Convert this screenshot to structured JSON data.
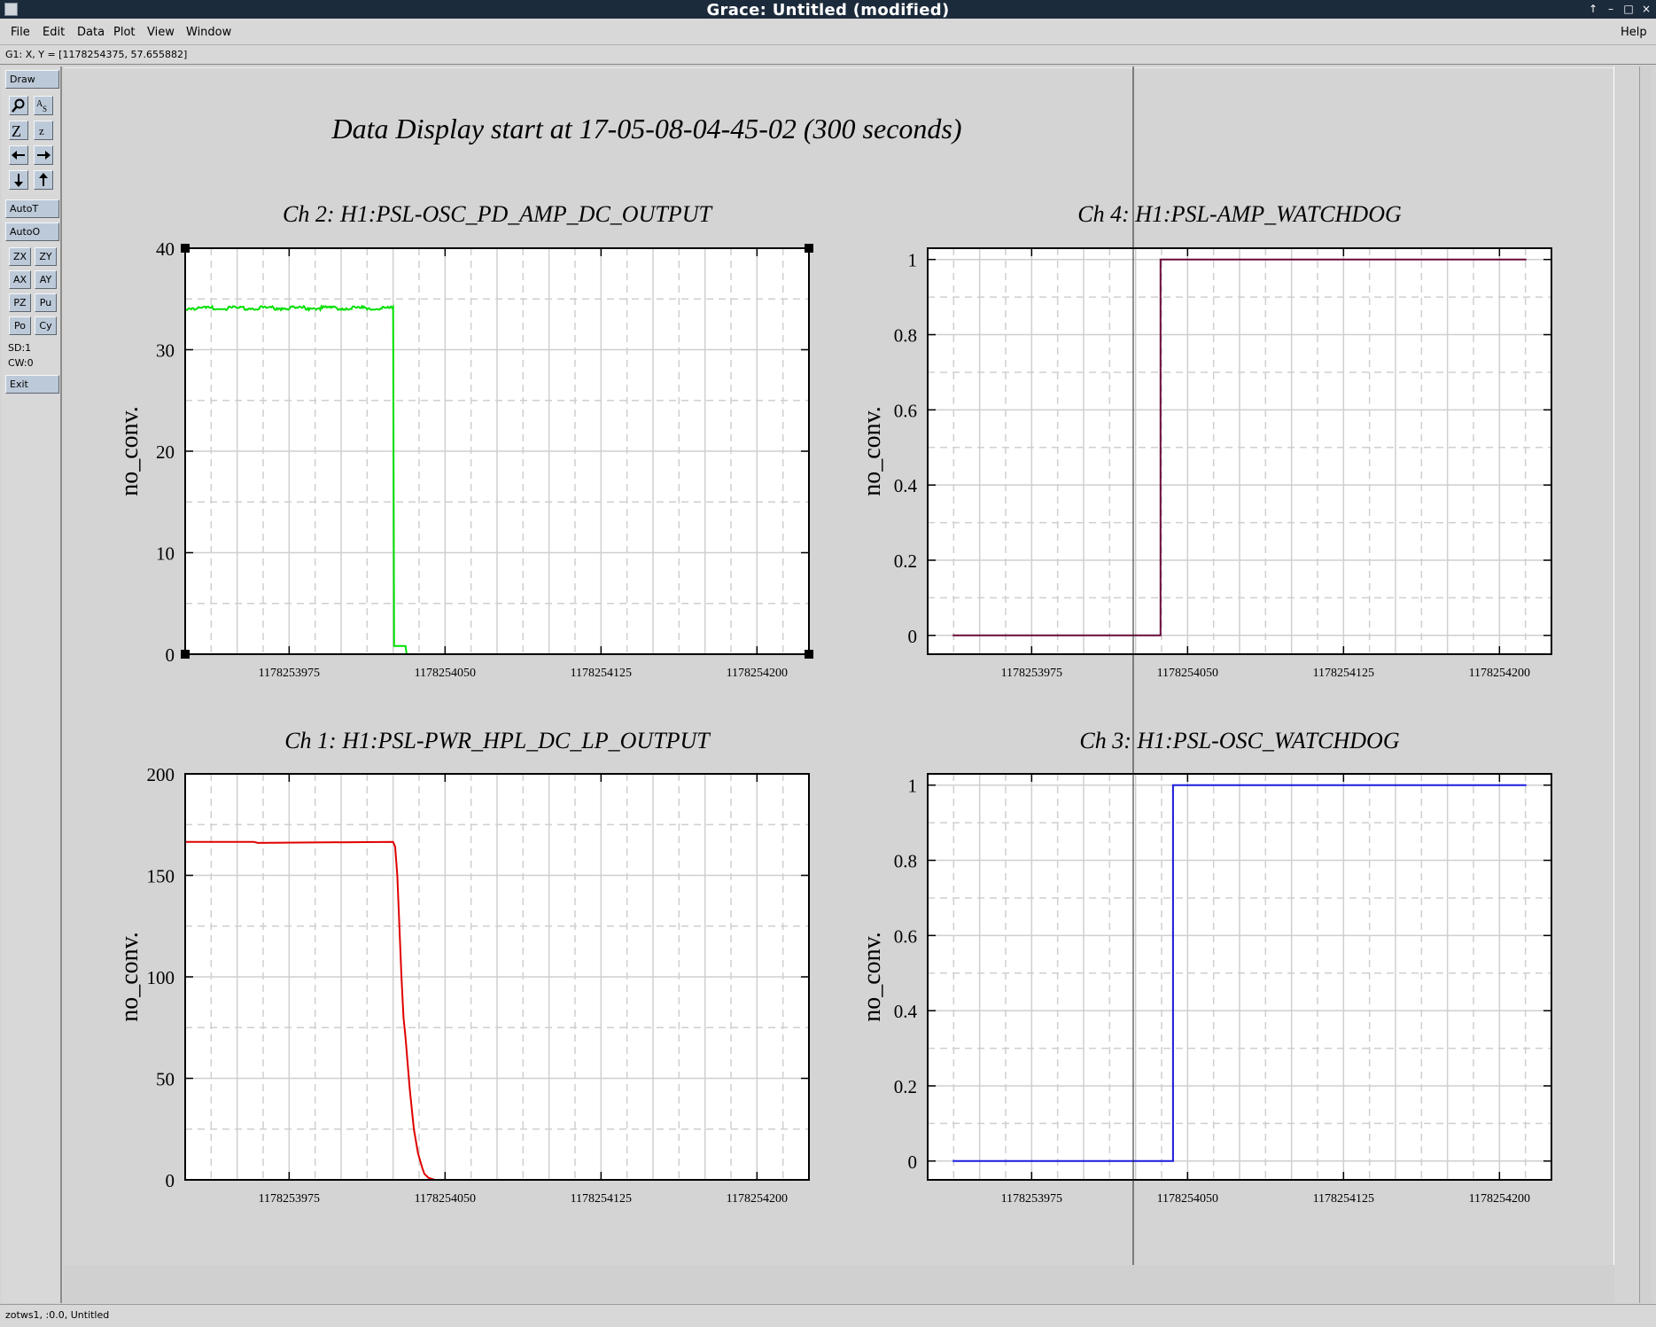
{
  "window": {
    "title": "Grace: Untitled (modified)"
  },
  "menu": {
    "file": "File",
    "edit": "Edit",
    "data": "Data",
    "plot": "Plot",
    "view": "View",
    "window": "Window",
    "help": "Help"
  },
  "locator": "G1: X, Y = [1178254375, 57.655882]",
  "toolbar": {
    "draw": "Draw",
    "autot": "AutoT",
    "autoo": "AutoO",
    "zx": "ZX",
    "zy": "ZY",
    "ax": "AX",
    "ay": "AY",
    "pz": "PZ",
    "pu": "Pu",
    "po": "Po",
    "cy": "Cy",
    "sd": "SD:1",
    "cw": "CW:0",
    "exit": "Exit"
  },
  "status": "zotws1, :0.0, Untitled",
  "page_title": "Data Display start at 17-05-08-04-45-02 (300 seconds)",
  "colors": {
    "ch2": "#00e000",
    "ch1": "#e00000",
    "ch4": "#6a0a3a",
    "ch3": "#1a1adf",
    "canvas": "#d4d4d4",
    "title_bar": "#1c2b3c"
  },
  "chart_data": [
    {
      "type": "line",
      "title": "Ch 2: H1:PSL-OSC_PD_AMP_DC_OUTPUT",
      "ylabel": "no_conv.",
      "xlim": [
        1178253925,
        1178254225
      ],
      "ylim": [
        0,
        40
      ],
      "xticks": [
        "1178253975",
        "1178254050",
        "1178254125",
        "1178254200"
      ],
      "yticks": [
        "0",
        "10",
        "20",
        "30",
        "40"
      ],
      "grid": true,
      "series": [
        {
          "color": "#00e000",
          "noise": 0.2,
          "x": [
            1178253925,
            1178254025,
            1178254025.5,
            1178254031,
            1178254031.5,
            1178254032
          ],
          "y": [
            34.1,
            34.1,
            0.8,
            0.8,
            0,
            0
          ]
        }
      ]
    },
    {
      "type": "line",
      "title": "Ch 4: H1:PSL-AMP_WATCHDOG",
      "ylabel": "no_conv.",
      "xlim": [
        1178253925,
        1178254225
      ],
      "ylim": [
        -0.05,
        1.03
      ],
      "xticks": [
        "1178253975",
        "1178254050",
        "1178254125",
        "1178254200"
      ],
      "yticks": [
        "0",
        "0.2",
        "0.4",
        "0.6",
        "0.8",
        "1"
      ],
      "grid": true,
      "series": [
        {
          "color": "#6a0a3a",
          "x": [
            1178253937,
            1178254037,
            1178254037,
            1178254213
          ],
          "y": [
            0,
            0,
            1,
            1
          ]
        }
      ]
    },
    {
      "type": "line",
      "title": "Ch 1: H1:PSL-PWR_HPL_DC_LP_OUTPUT",
      "ylabel": "no_conv.",
      "xlim": [
        1178253925,
        1178254225
      ],
      "ylim": [
        0,
        200
      ],
      "xticks": [
        "1178253975",
        "1178254050",
        "1178254125",
        "1178254200"
      ],
      "yticks": [
        "0",
        "50",
        "100",
        "150",
        "200"
      ],
      "grid": true,
      "series": [
        {
          "color": "#e00000",
          "x": [
            1178253925,
            1178253958,
            1178253960,
            1178254025,
            1178254026,
            1178254027,
            1178254029,
            1178254030,
            1178254031,
            1178254033,
            1178254035,
            1178254037,
            1178254039,
            1178254040,
            1178254042,
            1178254045,
            1178254050
          ],
          "y": [
            166.5,
            166.5,
            166,
            166.5,
            164,
            150,
            100,
            80,
            70,
            45,
            25,
            13,
            6,
            3,
            1,
            0,
            0
          ]
        }
      ]
    },
    {
      "type": "line",
      "title": "Ch 3: H1:PSL-OSC_WATCHDOG",
      "ylabel": "no_conv.",
      "xlim": [
        1178253925,
        1178254225
      ],
      "ylim": [
        -0.05,
        1.03
      ],
      "xticks": [
        "1178253975",
        "1178254050",
        "1178254125",
        "1178254200"
      ],
      "yticks": [
        "0",
        "0.2",
        "0.4",
        "0.6",
        "0.8",
        "1"
      ],
      "grid": true,
      "series": [
        {
          "color": "#1a1adf",
          "x": [
            1178253937,
            1178254043,
            1178254043,
            1178254213
          ],
          "y": [
            0,
            0,
            1,
            1
          ]
        }
      ]
    }
  ]
}
